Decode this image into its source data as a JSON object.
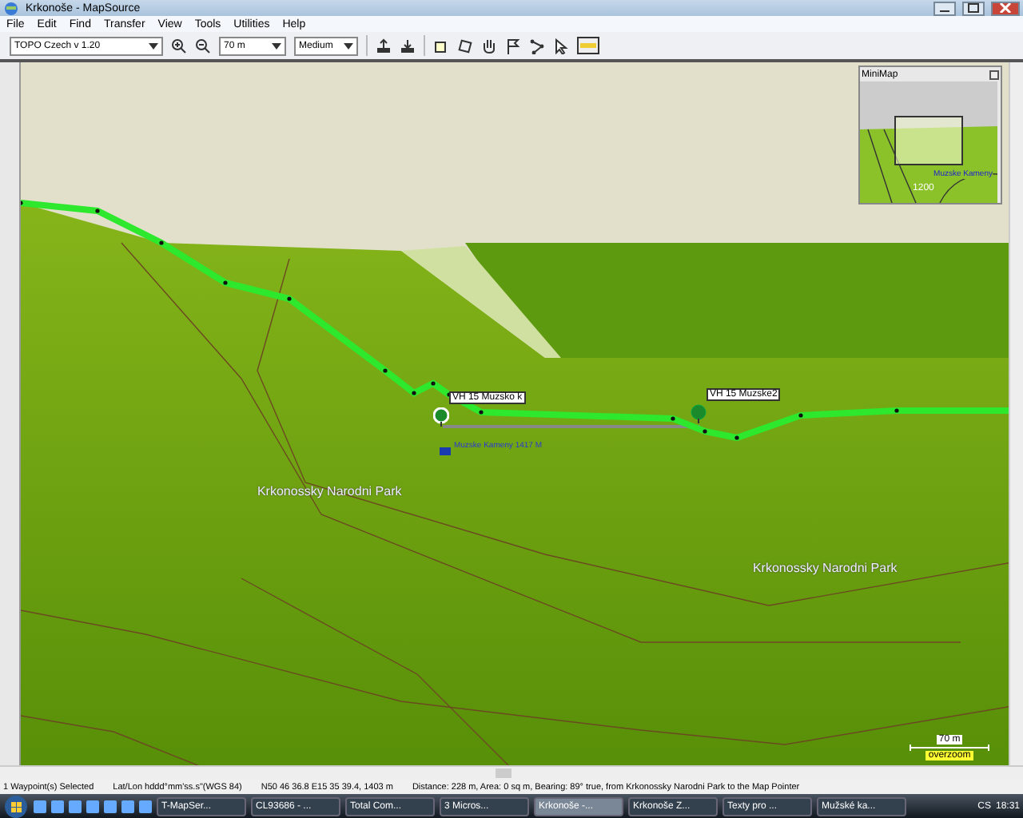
{
  "window": {
    "title": "Krkonoše - MapSource"
  },
  "menu": [
    "File",
    "Edit",
    "Find",
    "Transfer",
    "View",
    "Tools",
    "Utilities",
    "Help"
  ],
  "toolbar": {
    "map_product": "TOPO Czech v 1.20",
    "zoom": "70 m",
    "detail": "Medium"
  },
  "minimap": {
    "title": "MiniMap",
    "label": "Muzske Kameny",
    "contour": "1200"
  },
  "map": {
    "waypoints": [
      {
        "label": "VH 15 Muzsko k",
        "selected": true
      },
      {
        "label": "VH 15 Muzske2",
        "selected": false
      }
    ],
    "poi": "Muzske Kameny 1417 M",
    "areas": [
      "Krkonossky Narodni Park",
      "Krkonossky Narodni Park"
    ],
    "scale": {
      "distance": "70 m",
      "note": "overzoom"
    }
  },
  "status_bar": [
    "1 Waypoint(s) Selected",
    "Lat/Lon hddd°mm'ss.s\"(WGS 84)",
    "N50 46 36.8 E15 35 39.4, 1403 m",
    "Distance: 228 m, Area: 0 sq m, Bearing: 89° true, from Krkonossky Narodni Park to the Map Pointer"
  ],
  "taskbar": {
    "items": [
      {
        "label": "T-MapSer...",
        "selected": false
      },
      {
        "label": "CL93686 - ...",
        "selected": false
      },
      {
        "label": "Total Com...",
        "selected": false
      },
      {
        "label": "3 Micros...",
        "selected": false
      },
      {
        "label": "Krkonoše -...",
        "selected": true
      },
      {
        "label": "Krkonoše Z...",
        "selected": false
      },
      {
        "label": "Texty pro ...",
        "selected": false
      },
      {
        "label": "Mužské ka...",
        "selected": false
      }
    ],
    "language": "CS",
    "time": "18:31"
  }
}
